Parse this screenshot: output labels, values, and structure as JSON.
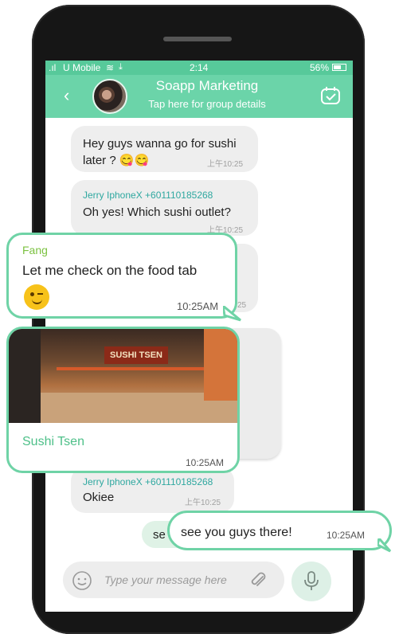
{
  "status_bar": {
    "carrier": "U Mobile",
    "time": "2:14",
    "battery": "56%"
  },
  "header": {
    "title": "Soapp Marketing",
    "subtitle": "Tap here for group details"
  },
  "messages": [
    {
      "text_line1": "Hey guys wanna go for sushi",
      "text_line2": "later ? 😋😋",
      "time": "上午10:25"
    },
    {
      "sender": "Jerry IphoneX +601110185268",
      "text": "Oh yes! Which sushi outlet?",
      "time": "上午10:25"
    },
    {
      "partial_time": "25"
    },
    {
      "sender": "Jerry IphoneX +601110185268",
      "text": "Okiee",
      "time": "上午10:25"
    },
    {
      "partial_text": "se"
    }
  ],
  "callouts": {
    "fang": {
      "sender": "Fang",
      "text": "Let me check on the food tab",
      "emoji": "😉",
      "time": "10:25AM"
    },
    "restaurant": {
      "name": "Sushi Tsen",
      "time": "10:25AM",
      "sign": "SUSHI TSEN"
    },
    "outgoing": {
      "text": "see you guys there!",
      "time": "10:25AM"
    }
  },
  "input": {
    "placeholder": "Type your message here"
  },
  "colors": {
    "accent": "#6bd4a9",
    "status_bar": "#57c99a",
    "callout_border": "#6fd3a6",
    "sender_name": "#2fa8a0",
    "fang_name": "#7cc241"
  },
  "icons": [
    "signal-icon",
    "wifi-icon",
    "download-icon",
    "battery-icon",
    "back-icon",
    "calendar-check-icon",
    "emoji-icon",
    "attach-icon",
    "mic-icon"
  ]
}
